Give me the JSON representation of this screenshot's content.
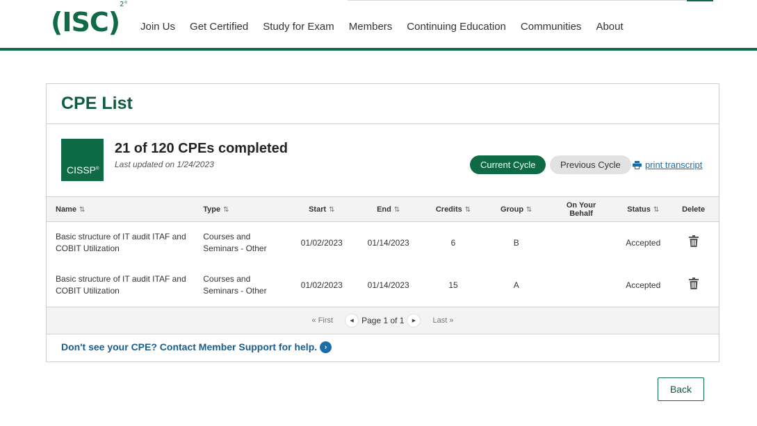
{
  "header": {
    "logo_text": "(ISC)",
    "logo_sup": "2°",
    "nav": [
      "Join Us",
      "Get Certified",
      "Study for Exam",
      "Members",
      "Continuing Education",
      "Communities",
      "About"
    ]
  },
  "card": {
    "title": "CPE List",
    "badge_text": "CISSP",
    "badge_sup": "®",
    "count_text": "21 of 120 CPEs completed",
    "updated_text": "Last updated on 1/24/2023",
    "current_cycle_label": "Current Cycle",
    "previous_cycle_label": "Previous Cycle",
    "print_label": "print transcript"
  },
  "table": {
    "columns": [
      "Name",
      "Type",
      "Start",
      "End",
      "Credits",
      "Group",
      "On Your Behalf",
      "Status",
      "Delete"
    ],
    "rows": [
      {
        "name": "Basic structure of IT audit ITAF and COBIT Utilization",
        "type": "Courses and Seminars - Other",
        "start": "01/02/2023",
        "end": "01/14/2023",
        "credits": "6",
        "group": "B",
        "on_behalf": "",
        "status": "Accepted"
      },
      {
        "name": "Basic structure of IT audit ITAF and COBIT Utilization",
        "type": "Courses and Seminars - Other",
        "start": "01/02/2023",
        "end": "01/14/2023",
        "credits": "15",
        "group": "A",
        "on_behalf": "",
        "status": "Accepted"
      }
    ]
  },
  "pager": {
    "first_label": "« First",
    "page_label": "Page 1 of 1",
    "last_label": "Last »"
  },
  "help_text": "Don't see your CPE? Contact Member Support for help.",
  "back_label": "Back",
  "colors": {
    "brand_green": "#0f6b45",
    "link_blue": "#1a6ea8"
  }
}
